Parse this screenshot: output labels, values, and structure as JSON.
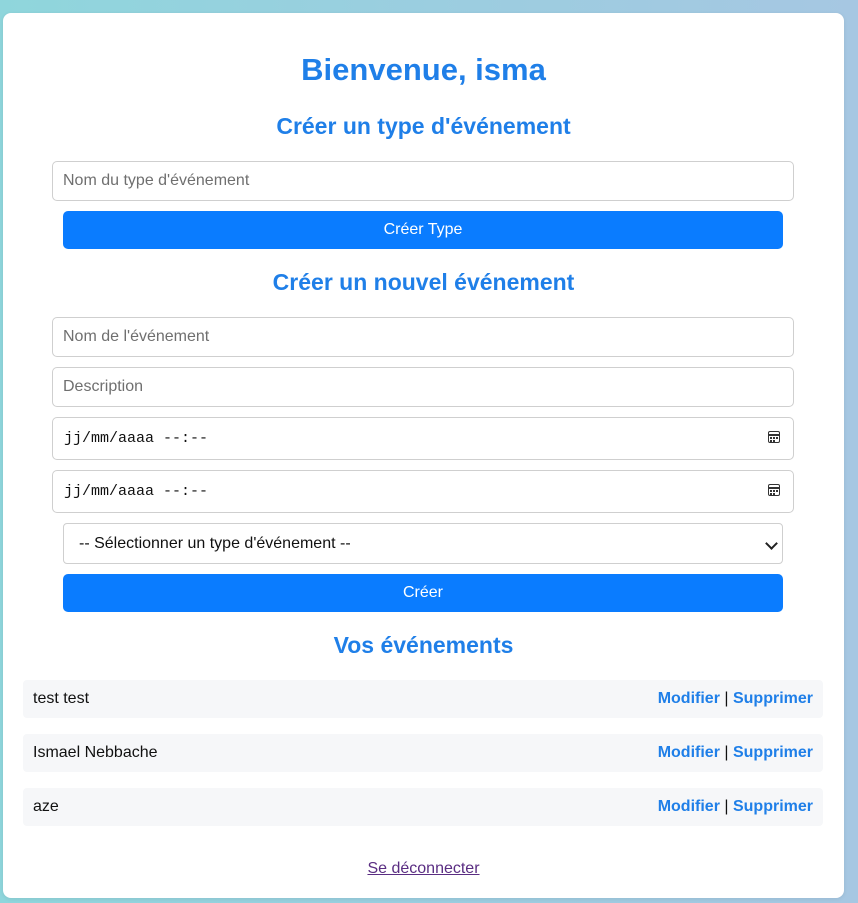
{
  "welcome": "Bienvenue, isma",
  "type_section": {
    "title": "Créer un type d'événement",
    "name_placeholder": "Nom du type d'événement",
    "create_button": "Créer Type"
  },
  "event_section": {
    "title": "Créer un nouvel événement",
    "name_placeholder": "Nom de l'événement",
    "description_placeholder": "Description",
    "start_date_value": "jj/mm/aaaa --:--",
    "end_date_value": "jj/mm/aaaa --:--",
    "type_select_value": "-- Sélectionner un type d'événement --",
    "create_button": "Créer"
  },
  "events_section": {
    "title": "Vos événements",
    "items": [
      {
        "name": "test test",
        "edit": "Modifier",
        "sep": "|",
        "delete": "Supprimer"
      },
      {
        "name": "Ismael Nebbache",
        "edit": "Modifier",
        "sep": "|",
        "delete": "Supprimer"
      },
      {
        "name": "aze",
        "edit": "Modifier",
        "sep": "|",
        "delete": "Supprimer"
      }
    ]
  },
  "logout": "Se déconnecter",
  "colors": {
    "accent": "#1f7fe8",
    "button": "#0a7cff",
    "row_bg": "#f6f7f9",
    "logout_link": "#5a2d82"
  }
}
